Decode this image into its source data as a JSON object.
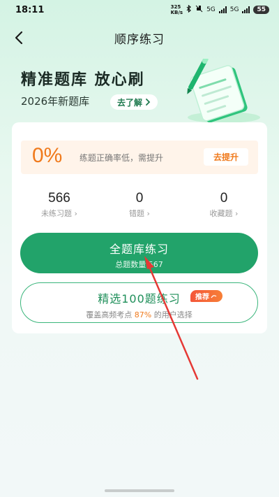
{
  "status": {
    "time": "18:11",
    "speed_value": "325",
    "speed_unit": "KB/s",
    "net1": "5G",
    "net2": "5G",
    "battery": "55"
  },
  "nav": {
    "title": "顺序练习"
  },
  "hero": {
    "title": "精准题库 放心刷",
    "subtitle": "2026年新题库",
    "learn_more": "去了解"
  },
  "accuracy": {
    "percent": "0%",
    "message": "练题正确率低，需提升",
    "action": "去提升"
  },
  "stats": [
    {
      "value": "566",
      "label": "未练习题"
    },
    {
      "value": "0",
      "label": "错题"
    },
    {
      "value": "0",
      "label": "收藏题"
    }
  ],
  "full_practice": {
    "label": "全题库练习",
    "count_text": "总题数量 567"
  },
  "selected_practice": {
    "label": "精选100题练习",
    "badge": "推荐",
    "desc_prefix": "覆盖高频考点 ",
    "desc_highlight": "87%",
    "desc_suffix": " 的用户选择"
  },
  "colors": {
    "accent": "#22a36a",
    "accent_text": "#1f8f5a",
    "warning": "#f07a1c",
    "annotation": "#e53935"
  }
}
